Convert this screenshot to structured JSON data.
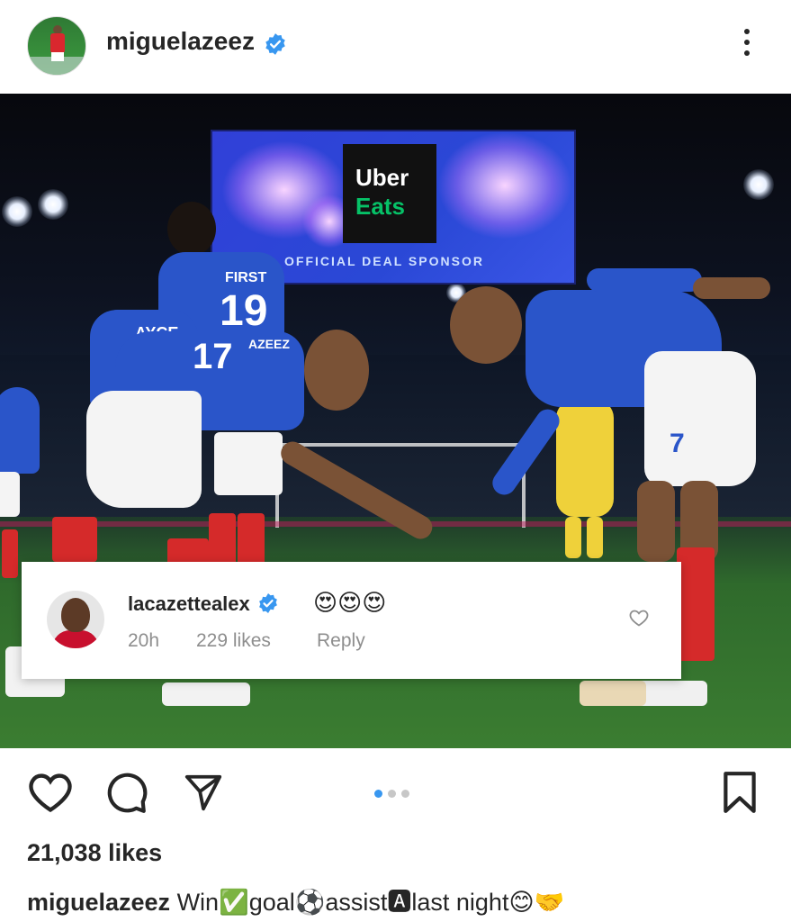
{
  "post": {
    "username": "miguelazeez",
    "verified": true,
    "avatar": "profile-avatar",
    "more_icon": "more-vertical-icon"
  },
  "photo": {
    "screen_logo_line1": "Uber",
    "screen_logo_line2": "Eats",
    "screen_caption": "OFFICIAL DEAL SPONSOR",
    "shirt_name_1": "AYCE",
    "shirt_name_2": "AZEEZ",
    "shirt_name_3": "FIRST",
    "shirt_number_front": "19",
    "shirt_number_back": "17"
  },
  "comment": {
    "username": "lacazettealex",
    "verified": true,
    "text": "😍😍😍",
    "time": "20h",
    "likes": "229 likes",
    "reply": "Reply"
  },
  "actions": {
    "like_icon": "heart-icon",
    "comment_icon": "comment-icon",
    "share_icon": "send-icon",
    "save_icon": "bookmark-icon",
    "carousel_total": 3,
    "carousel_active": 1
  },
  "likes_text": "21,038 likes",
  "caption": {
    "username": "miguelazeez",
    "text": "Win✅goal⚽assist🅰last night😊🤝"
  },
  "colors": {
    "verified": "#3897f0",
    "text": "#262626",
    "muted": "#8e8e8e",
    "active_dot": "#3897f0"
  }
}
